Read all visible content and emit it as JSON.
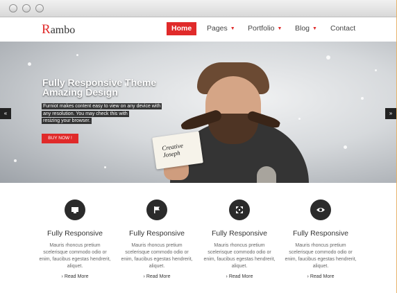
{
  "brand": {
    "first_letter": "R",
    "rest": "ambo"
  },
  "nav": {
    "home": "Home",
    "pages": "Pages",
    "portfolio": "Portfolio",
    "blog": "Blog",
    "contact": "Contact",
    "caret": "▼"
  },
  "hero": {
    "title_line1": "Fully Responsive Theme",
    "title_line2": "Amazing Design",
    "desc_line1": "Furniot makes content easy to view on any device with",
    "desc_line2": "any resolution. You may check this with",
    "desc_line3": "resizing your browser.",
    "button": "BUY NOW !",
    "card_line1": "Creative",
    "card_line2": "Joseph",
    "prev": "«",
    "next": "»"
  },
  "features": [
    {
      "icon": "monitor-icon",
      "title": "Fully Responsive",
      "text": "Mauris rhoncus pretium scelerisque commodo odio or enim, faucibus egestas hendrerit, aliquet.",
      "link": "Read More"
    },
    {
      "icon": "flag-icon",
      "title": "Fully Responsive",
      "text": "Mauris rhoncus pretium scelerisque commodo odio or enim, faucibus egestas hendrerit, aliquet.",
      "link": "Read More"
    },
    {
      "icon": "expand-icon",
      "title": "Fully Responsive",
      "text": "Mauris rhoncus pretium scelerisque commodo odio or enim, faucibus egestas hendrerit, aliquet.",
      "link": "Read More"
    },
    {
      "icon": "eye-icon",
      "title": "Fully Responsive",
      "text": "Mauris rhoncus pretium scelerisque commodo odio or enim, faucibus egestas hendrerit, aliquet.",
      "link": "Read More"
    }
  ],
  "colors": {
    "accent": "#e02a2a",
    "dark": "#2b2b2b"
  }
}
